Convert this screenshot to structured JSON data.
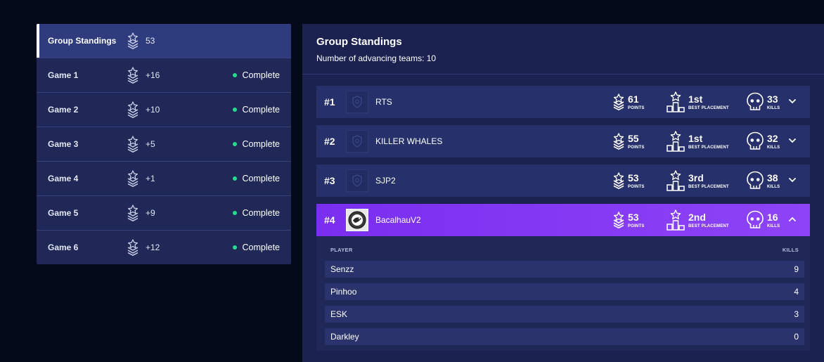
{
  "sidebar": {
    "items": [
      {
        "label": "Group Standings",
        "points": "53",
        "status": "",
        "active": true
      },
      {
        "label": "Game 1",
        "points": "+16",
        "status": "Complete"
      },
      {
        "label": "Game 2",
        "points": "+10",
        "status": "Complete"
      },
      {
        "label": "Game 3",
        "points": "+5",
        "status": "Complete"
      },
      {
        "label": "Game 4",
        "points": "+1",
        "status": "Complete"
      },
      {
        "label": "Game 5",
        "points": "+9",
        "status": "Complete"
      },
      {
        "label": "Game 6",
        "points": "+12",
        "status": "Complete"
      }
    ]
  },
  "main": {
    "title": "Group Standings",
    "subtitle": "Number of advancing teams: 10",
    "labels": {
      "points": "POINTS",
      "placement": "BEST PLACEMENT",
      "kills": "KILLS"
    },
    "teams": [
      {
        "rank": "#1",
        "name": "RTS",
        "points": "61",
        "placement": "1st",
        "kills": "33"
      },
      {
        "rank": "#2",
        "name": "KILLER WHALES",
        "points": "55",
        "placement": "1st",
        "kills": "32"
      },
      {
        "rank": "#3",
        "name": "SJP2",
        "points": "53",
        "placement": "3rd",
        "kills": "38"
      },
      {
        "rank": "#4",
        "name": "BacalhauV2",
        "points": "53",
        "placement": "2nd",
        "kills": "16"
      }
    ],
    "players_table": {
      "col_player": "PLAYER",
      "col_kills": "KILLS",
      "rows": [
        {
          "name": "Senzz",
          "kills": "9"
        },
        {
          "name": "Pinhoo",
          "kills": "4"
        },
        {
          "name": "ESK",
          "kills": "3"
        },
        {
          "name": "Darkley",
          "kills": "0"
        }
      ]
    }
  },
  "icons": {
    "points": "points-badge-icon",
    "placement": "podium-icon",
    "kills": "skull-icon",
    "status": "status-dot-icon"
  },
  "colors": {
    "background": "#050a1b",
    "panel": "#1f2856",
    "expanded_row": "#8d44f6",
    "status_complete": "#22e08a"
  }
}
